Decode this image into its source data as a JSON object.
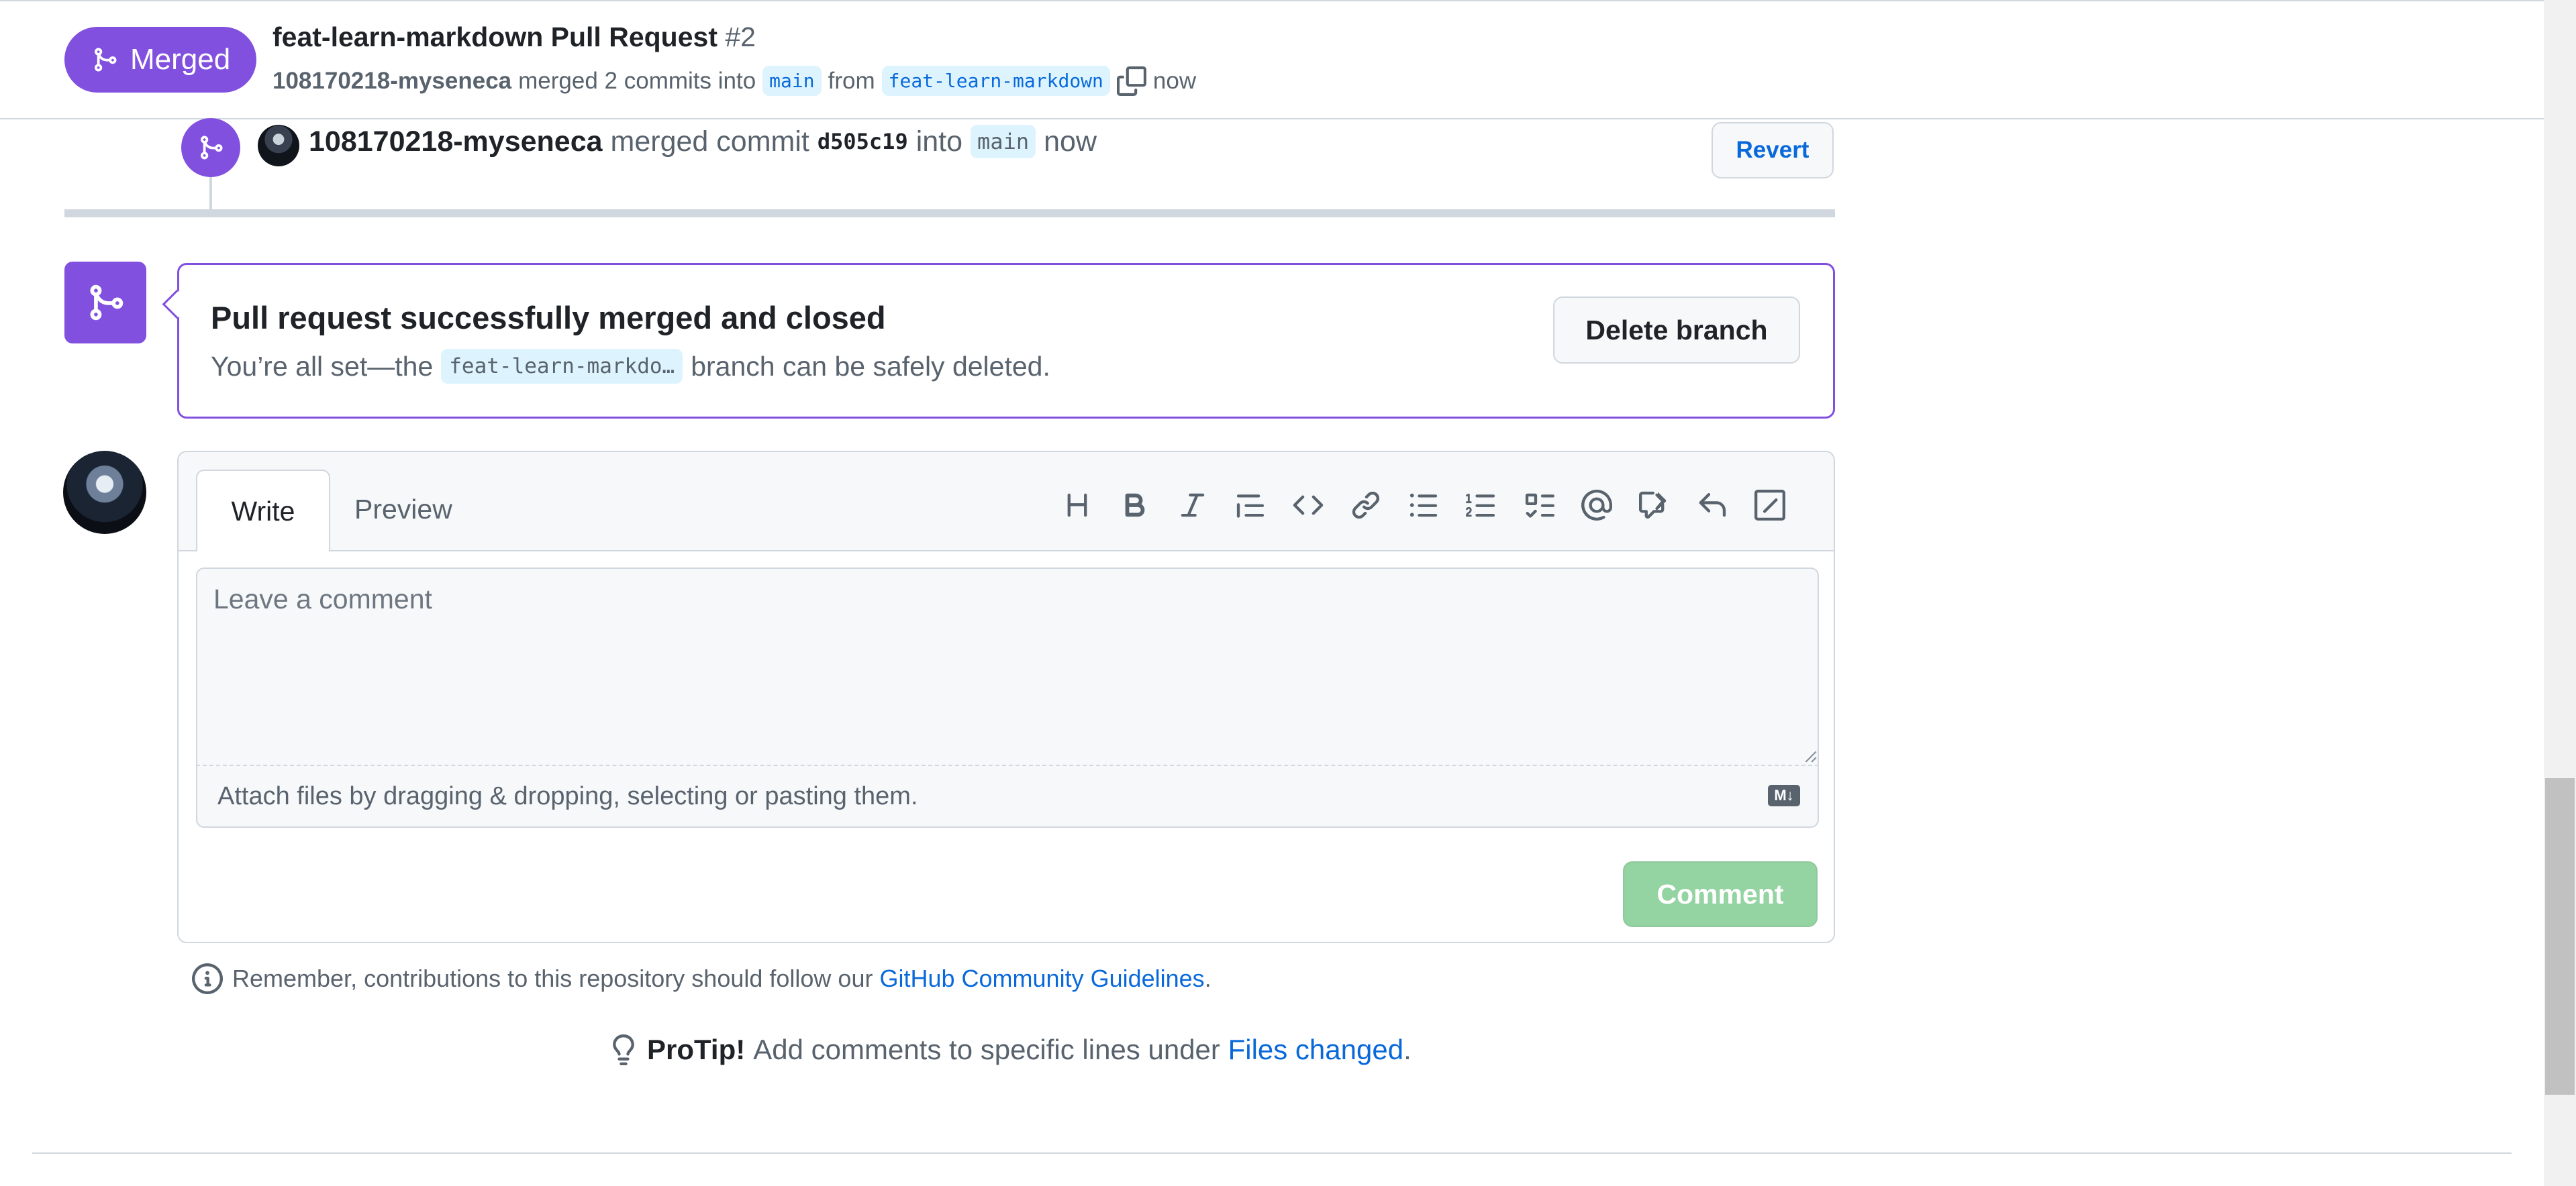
{
  "header": {
    "state_label": "Merged",
    "title": "feat-learn-markdown Pull Request",
    "number": "#2",
    "author": "108170218-myseneca",
    "merged_text": "merged 2 commits into",
    "base_branch": "main",
    "from_text": "from",
    "head_branch": "feat-learn-markdown",
    "time": "now"
  },
  "event": {
    "author": "108170218-myseneca",
    "action": "merged commit",
    "commit": "d505c19",
    "into_text": "into",
    "branch": "main",
    "time": "now",
    "revert_label": "Revert"
  },
  "merge_box": {
    "heading": "Pull request successfully merged and closed",
    "sub_prefix": "You’re all set—the",
    "branch": "feat-learn-markdo…",
    "sub_suffix": "branch can be safely deleted.",
    "delete_label": "Delete branch"
  },
  "composer": {
    "tab_write": "Write",
    "tab_preview": "Preview",
    "placeholder": "Leave a comment",
    "attach_text": "Attach files by dragging & dropping, selecting or pasting them.",
    "comment_label": "Comment",
    "markdown_badge": "M↓"
  },
  "guidelines": {
    "prefix": "Remember, contributions to this repository should follow our",
    "link": "GitHub Community Guidelines",
    "suffix": "."
  },
  "protip": {
    "label": "ProTip!",
    "text": "Add comments to specific lines under",
    "link": "Files changed",
    "suffix": "."
  },
  "colors": {
    "merged_purple": "#8250df",
    "link_blue": "#0969da",
    "comment_green_disabled": "#94d3a2"
  },
  "toolbar_icons": [
    "heading-icon",
    "bold-icon",
    "italic-icon",
    "quote-icon",
    "code-icon",
    "link-icon",
    "unordered-list-icon",
    "ordered-list-icon",
    "task-list-icon",
    "mention-icon",
    "reference-icon",
    "reply-icon",
    "slash-command-icon"
  ]
}
